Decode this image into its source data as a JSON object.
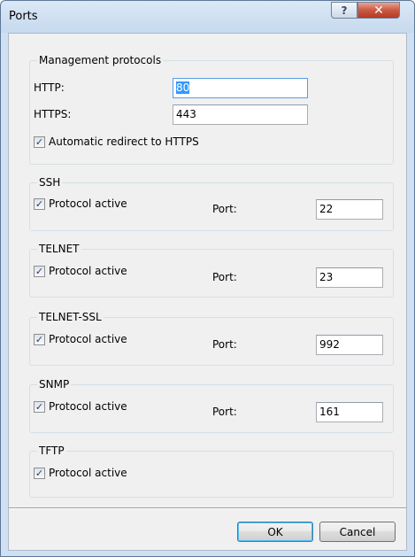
{
  "window": {
    "title": "Ports",
    "help_label": "?",
    "close_label": "✕"
  },
  "management": {
    "legend": "Management protocols",
    "http_label": "HTTP:",
    "http_value": "80",
    "https_label": "HTTPS:",
    "https_value": "443",
    "redirect_label": "Automatic redirect to HTTPS",
    "redirect_checked": true
  },
  "protocols": [
    {
      "legend": "SSH",
      "active_label": "Protocol active",
      "port_label": "Port:",
      "port_value": "22"
    },
    {
      "legend": "TELNET",
      "active_label": "Protocol active",
      "port_label": "Port:",
      "port_value": "23"
    },
    {
      "legend": "TELNET-SSL",
      "active_label": "Protocol active",
      "port_label": "Port:",
      "port_value": "992"
    },
    {
      "legend": "SNMP",
      "active_label": "Protocol active",
      "port_label": "Port:",
      "port_value": "161"
    },
    {
      "legend": "TFTP",
      "active_label": "Protocol active"
    }
  ],
  "checkmark": "✓",
  "buttons": {
    "ok_label": "OK",
    "cancel_label": "Cancel"
  }
}
